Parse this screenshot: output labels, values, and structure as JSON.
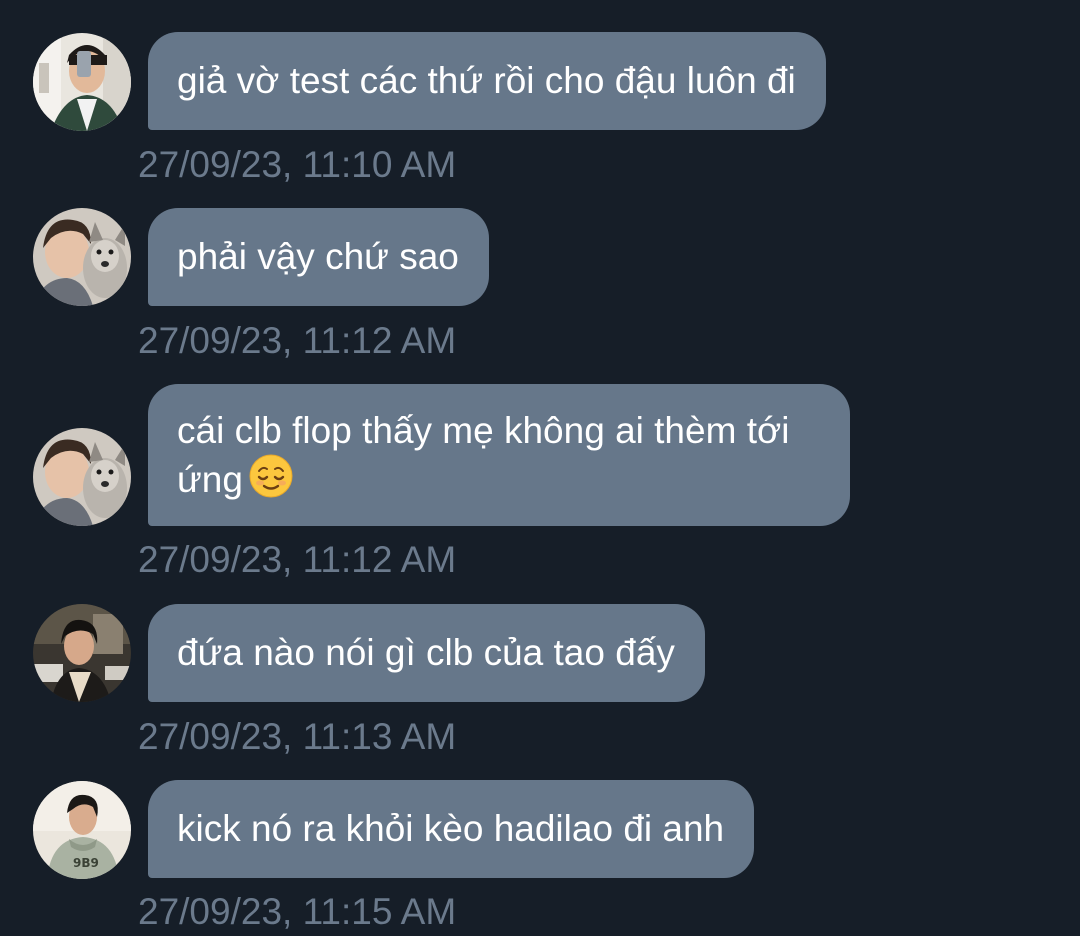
{
  "messages": [
    {
      "text": "giả vờ test các thứ rồi cho đậu luôn đi",
      "time": "27/09/23, 11:10 AM",
      "avatar": "avatar-mirror-selfie"
    },
    {
      "text": "phải vậy chứ sao",
      "time": "27/09/23, 11:12 AM",
      "avatar": "avatar-with-dog"
    },
    {
      "text_line1": "cái clb flop thấy mẹ không ai thèm tới",
      "text_line2": "ứng",
      "emoji": "relieved-face-emoji",
      "time": "27/09/23, 11:12 AM",
      "avatar": "avatar-with-dog"
    },
    {
      "text": "đứa nào nói gì clb của tao đấy",
      "time": "27/09/23, 11:13 AM",
      "avatar": "avatar-street"
    },
    {
      "text": "kick nó ra khỏi kèo hadilao đi anh",
      "time": "27/09/23, 11:15 AM",
      "avatar": "avatar-hoodie"
    }
  ],
  "colors": {
    "background": "#161e28",
    "bubble": "#66778a",
    "timestamp": "#6b7a8c",
    "text": "#ffffff"
  }
}
